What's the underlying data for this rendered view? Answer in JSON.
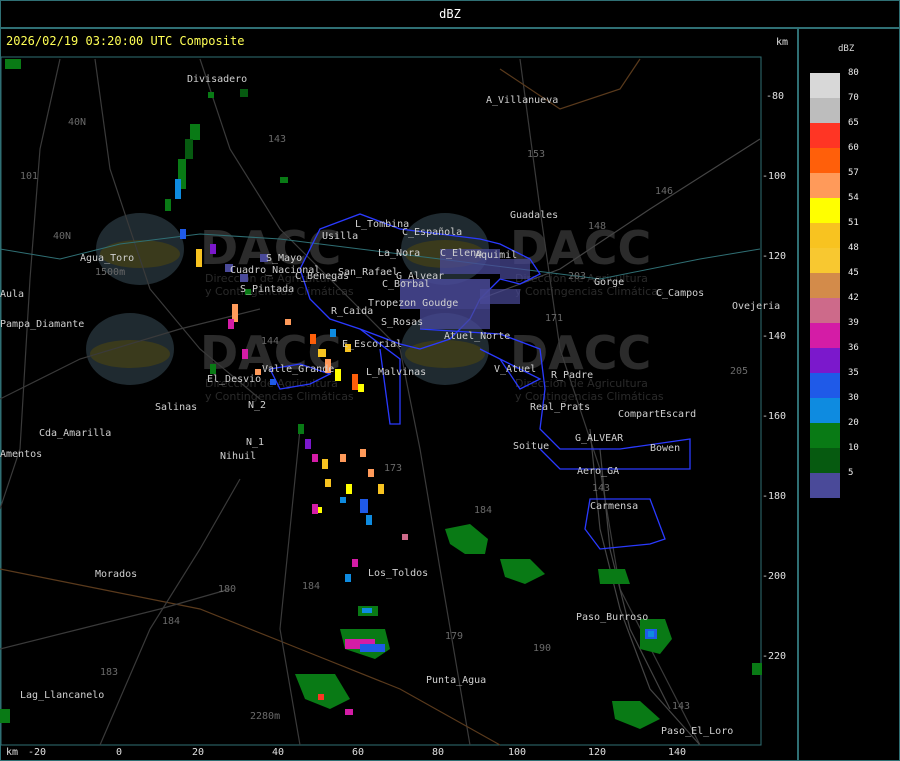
{
  "header": {
    "title": "dBZ"
  },
  "map": {
    "timestamp": "2026/02/19 03:20:00 UTC Composite",
    "unit": "km",
    "x_ticks": [
      "-20",
      "0",
      "20",
      "40",
      "60",
      "80",
      "100",
      "120",
      "140"
    ],
    "y_ticks": [
      "-80",
      "-100",
      "-120",
      "-140",
      "-160",
      "-180",
      "-200",
      "-220"
    ],
    "watermark_brand": "DACC",
    "watermark_line1": "Dirección de Agricultura",
    "watermark_line2": "y Contingencias Climáticas",
    "places": [
      "Divisadero",
      "A_Villanueva",
      "Guadales",
      "L_Tombina",
      "Usilla",
      "C_Española",
      "La_Nora",
      "C_Elena",
      "Aquimil",
      "San_Rafael",
      "S_Mayo",
      "C_Benegas",
      "C_Borbal",
      "G_Alvear",
      "C_Campos",
      "Gorge",
      "Agua_Toro",
      "Pampa_Diamante",
      "Cuadro_Nacional",
      "S_Pintada",
      "R_Caida",
      "Tropezon Goudge",
      "S_Rosas",
      "Atuel_Norte",
      "E_Escorial",
      "Valle_Grande",
      "L_Malvinas",
      "V_Atuel",
      "R_Padre",
      "El_Desvio",
      "Salinas",
      "N_2",
      "N_1",
      "Nihuil",
      "Cda_Amarilla",
      "Real_Prats",
      "Compart",
      "Escard",
      "G_ALVEAR",
      "Bowen",
      "Soitue",
      "Aero_GA",
      "Carmensa",
      "Los_Toldos",
      "Morados",
      "Paso_Burroso",
      "Punta_Agua",
      "Lag_Llancanelo",
      "Paso_El_Loro",
      "Ovejeria",
      "Aula",
      "Amentos"
    ],
    "road_numbers": [
      "153",
      "146",
      "148",
      "203",
      "171",
      "184",
      "144",
      "143",
      "101",
      "40N",
      "40N",
      "173",
      "180",
      "184",
      "179",
      "190",
      "143",
      "184",
      "183",
      "205",
      "1500m",
      "2280m",
      "143"
    ]
  },
  "legend": {
    "title": "dBZ",
    "items": [
      {
        "label": "80",
        "color": "#d8d8d8"
      },
      {
        "label": "70",
        "color": "#bdbdbd"
      },
      {
        "label": "65",
        "color": "#ff3524"
      },
      {
        "label": "60",
        "color": "#ff5f0a"
      },
      {
        "label": "57",
        "color": "#ff9a5a"
      },
      {
        "label": "54",
        "color": "#ffff00"
      },
      {
        "label": "51",
        "color": "#f8c320"
      },
      {
        "label": "48",
        "color": "#f8c830"
      },
      {
        "label": "45",
        "color": "#d38b4a"
      },
      {
        "label": "42",
        "color": "#cd6a8a"
      },
      {
        "label": "39",
        "color": "#d41ca6"
      },
      {
        "label": "36",
        "color": "#7b18cc"
      },
      {
        "label": "35",
        "color": "#1f5ae8"
      },
      {
        "label": "30",
        "color": "#0e8be0"
      },
      {
        "label": "20",
        "color": "#097a15"
      },
      {
        "label": "10",
        "color": "#065a10"
      },
      {
        "label": "5",
        "color": "#4a4a99"
      }
    ]
  }
}
